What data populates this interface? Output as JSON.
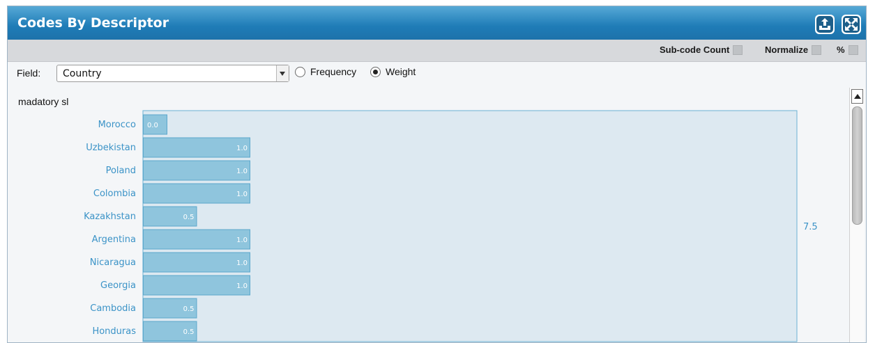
{
  "window": {
    "title": "Codes By Descriptor"
  },
  "icons": {
    "export": "upload-icon",
    "expand": "expand-icon"
  },
  "options": {
    "subcode_label": "Sub-code Count",
    "normalize_label": "Normalize",
    "percent_label": "%"
  },
  "field": {
    "label": "Field:",
    "value": "Country",
    "radio_frequency": "Frequency",
    "radio_weight": "Weight",
    "selected": "Weight"
  },
  "chart_data": {
    "type": "bar",
    "orientation": "horizontal",
    "title": "madatory sl",
    "categories": [
      "Morocco",
      "Uzbekistan",
      "Poland",
      "Colombia",
      "Kazakhstan",
      "Argentina",
      "Nicaragua",
      "Georgia",
      "Cambodia",
      "Honduras"
    ],
    "values": [
      0.0,
      1.0,
      1.0,
      1.0,
      0.5,
      1.0,
      1.0,
      1.0,
      0.5,
      0.5
    ],
    "value_labels": [
      "0.0",
      "1.0",
      "1.0",
      "1.0",
      "0.5",
      "1.0",
      "1.0",
      "1.0",
      "0.5",
      "0.5"
    ],
    "total_label": "7.5",
    "xlim": [
      0,
      6.0
    ],
    "colors": {
      "bar": "#8fc5dd",
      "bar_border": "#5ba8cc",
      "frame": "#dde9f1",
      "frame_border": "#6cb1d3",
      "label": "#3b93c7"
    }
  }
}
